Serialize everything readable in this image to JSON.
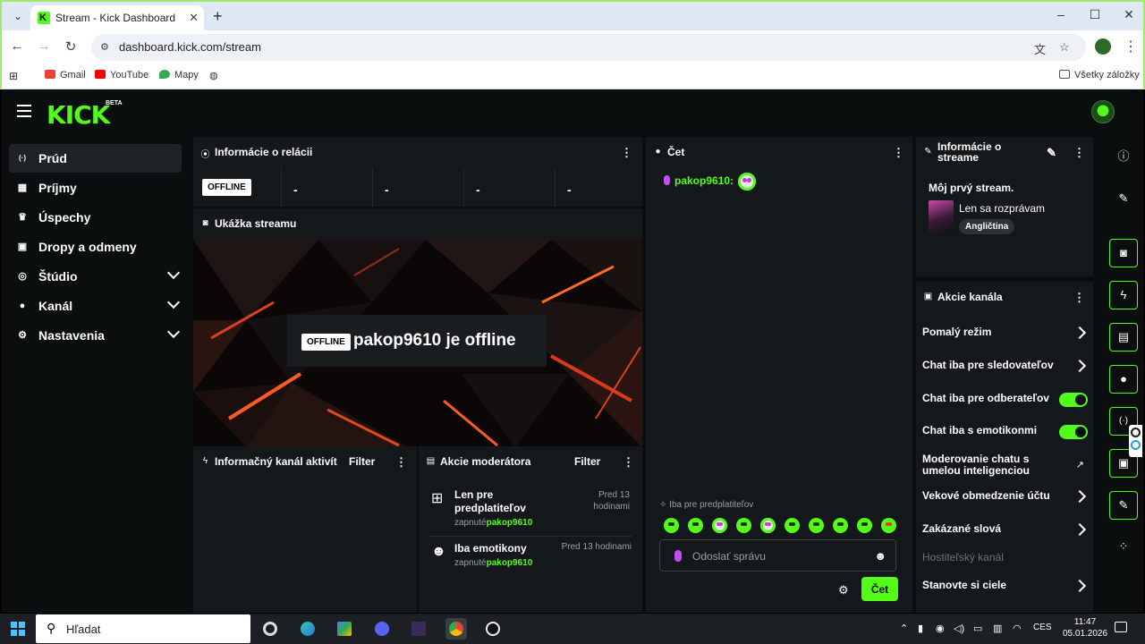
{
  "browser": {
    "tab_title": "Stream - Kick Dashboard",
    "tab_close": "✕",
    "new_tab": "+",
    "url": "dashboard.kick.com/stream",
    "window_controls": [
      "–",
      "☐",
      "✕"
    ],
    "bookmarks": [
      {
        "label": "Gmail",
        "color": "#ea4335"
      },
      {
        "label": "YouTube",
        "color": "#ff0000"
      },
      {
        "label": "Mapy",
        "color": "#34a853"
      }
    ],
    "all_bookmarks": "Všetky záložky"
  },
  "kick": {
    "logo": "KICK",
    "beta": "BETA",
    "brand_color": "#53fc18"
  },
  "sidebar": {
    "items": [
      {
        "label": "Prúd",
        "icon": "broadcast-icon",
        "glyph": "((·))",
        "active": true
      },
      {
        "label": "Príjmy",
        "icon": "revenue-icon",
        "glyph": "▦"
      },
      {
        "label": "Úspechy",
        "icon": "trophy-icon",
        "glyph": "🏆"
      },
      {
        "label": "Dropy a odmeny",
        "icon": "gift-icon",
        "glyph": "🎁"
      },
      {
        "label": "Štúdio",
        "icon": "studio-icon",
        "glyph": "◎",
        "expandable": true
      },
      {
        "label": "Kanál",
        "icon": "person-icon",
        "glyph": "👤",
        "expandable": true
      },
      {
        "label": "Nastavenia",
        "icon": "gear-icon",
        "glyph": "⚙",
        "expandable": true
      }
    ]
  },
  "session": {
    "title": "Informácie o relácii",
    "status": "OFFLINE",
    "stats": [
      "-",
      "-",
      "-",
      "-"
    ]
  },
  "preview": {
    "title": "Ukážka streamu",
    "badge": "OFFLINE",
    "message": "pakop9610 je offline"
  },
  "activity": {
    "title": "Informačný kanál aktivít",
    "filter": "Filter"
  },
  "mod_actions": {
    "title": "Akcie moderátora",
    "filter": "Filter",
    "items": [
      {
        "title": "Len pre predplatiteľov",
        "prefix": "zapnuté",
        "user": "pakop9610",
        "time": "Pred 13 hodinami"
      },
      {
        "title": "Iba emotikony",
        "prefix": "zapnuté",
        "user": "pakop9610",
        "time": "Pred 13 hodinami"
      }
    ]
  },
  "chat": {
    "title": "Čet",
    "message_user": "pakop9610:",
    "sub_only": "Iba pre predplatiteľov",
    "placeholder": "Odoslať správu",
    "send": "Čet"
  },
  "stream_info": {
    "title": "Informácie o streame",
    "stream_title": "Môj prvý stream.",
    "category": "Len sa rozprávam",
    "language": "Angličtina"
  },
  "channel_actions": {
    "title": "Akcie kanála",
    "items": [
      {
        "label": "Pomalý režim",
        "control": "chevron"
      },
      {
        "label": "Chat iba pre sledovateľov",
        "control": "chevron"
      },
      {
        "label": "Chat iba pre odberateľov",
        "control": "toggle",
        "on": true
      },
      {
        "label": "Chat iba s emotikonmi",
        "control": "toggle",
        "on": true
      },
      {
        "label": "Moderovanie chatu s umelou inteligenciou",
        "control": "external"
      },
      {
        "label": "Vekové obmedzenie účtu",
        "control": "chevron"
      },
      {
        "label": "Zakázané slová",
        "control": "chevron"
      },
      {
        "label": "Hostiteľský kanál",
        "control": "none",
        "disabled": true
      },
      {
        "label": "Stanovte si ciele",
        "control": "chevron"
      }
    ]
  },
  "taskbar": {
    "search": "Hľadat",
    "lang": "CES",
    "time": "11:47",
    "date": "05.01.2026"
  }
}
